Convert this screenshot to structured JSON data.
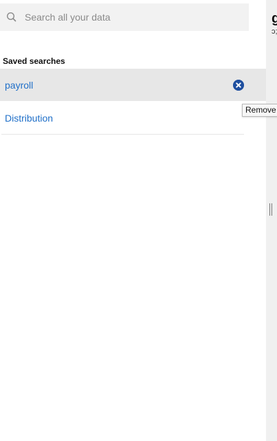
{
  "search": {
    "placeholder": "Search all your data"
  },
  "saved_searches": {
    "title": "Saved searches",
    "items": [
      {
        "label": "payroll"
      },
      {
        "label": "Distribution"
      }
    ]
  },
  "tooltip": {
    "text": "Remove"
  },
  "right_panel": {
    "heading_fragment": "g",
    "subtext_fragment": "ɔ;"
  },
  "colors": {
    "link": "#1f6fc8",
    "remove_button": "#1f4f9f",
    "selected_row": "#e7e7e7"
  },
  "icons": {
    "search": "search-icon",
    "remove": "close-circle-icon",
    "splitter": "drag-handle-icon"
  }
}
